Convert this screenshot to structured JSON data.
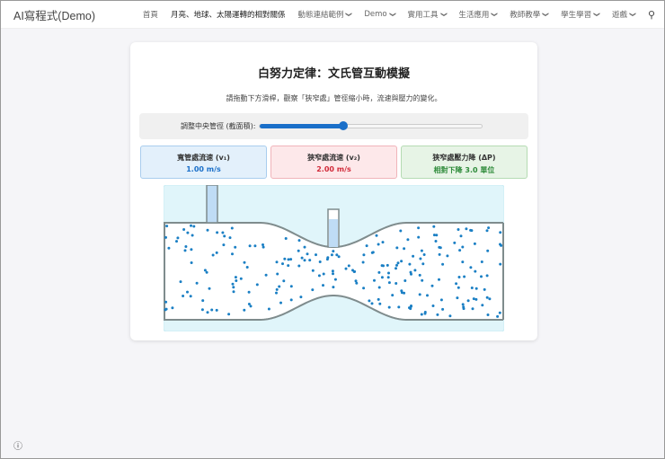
{
  "nav": {
    "brand": "AI寫程式(Demo)",
    "items": [
      {
        "label": "首頁",
        "dropdown": false
      },
      {
        "label": "月亮、地球、太陽運轉的相對關係",
        "dropdown": false,
        "active": true
      },
      {
        "label": "動態連結範例",
        "dropdown": true
      },
      {
        "label": "Demo",
        "dropdown": true
      },
      {
        "label": "實用工具",
        "dropdown": true
      },
      {
        "label": "生活應用",
        "dropdown": true
      },
      {
        "label": "教師教學",
        "dropdown": true
      },
      {
        "label": "學生學習",
        "dropdown": true
      },
      {
        "label": "遊戲",
        "dropdown": true
      }
    ],
    "search_icon": "search-icon"
  },
  "main": {
    "title": "白努力定律：文氏管互動模擬",
    "subtitle": "請拖動下方滑桿，觀察「狹窄處」管徑縮小時，流速與壓力的變化。",
    "slider": {
      "label": "調整中央管徑 (截面積):",
      "value": 0.5,
      "min": 0.2,
      "max": 1.0
    },
    "stats": [
      {
        "label": "寬管處流速 (v₁)",
        "value": "1.00 m/s"
      },
      {
        "label": "狹窄處流速 (v₂)",
        "value": "2.00 m/s"
      },
      {
        "label": "狹窄處壓力降 (ΔP)",
        "value": "相對下降 3.0 單位"
      }
    ]
  },
  "colors": {
    "accent": "#1a6fc9",
    "particle": "#1a7fc4",
    "sky": "#e0f5fa"
  },
  "footer": {
    "info_icon": "info-icon"
  }
}
